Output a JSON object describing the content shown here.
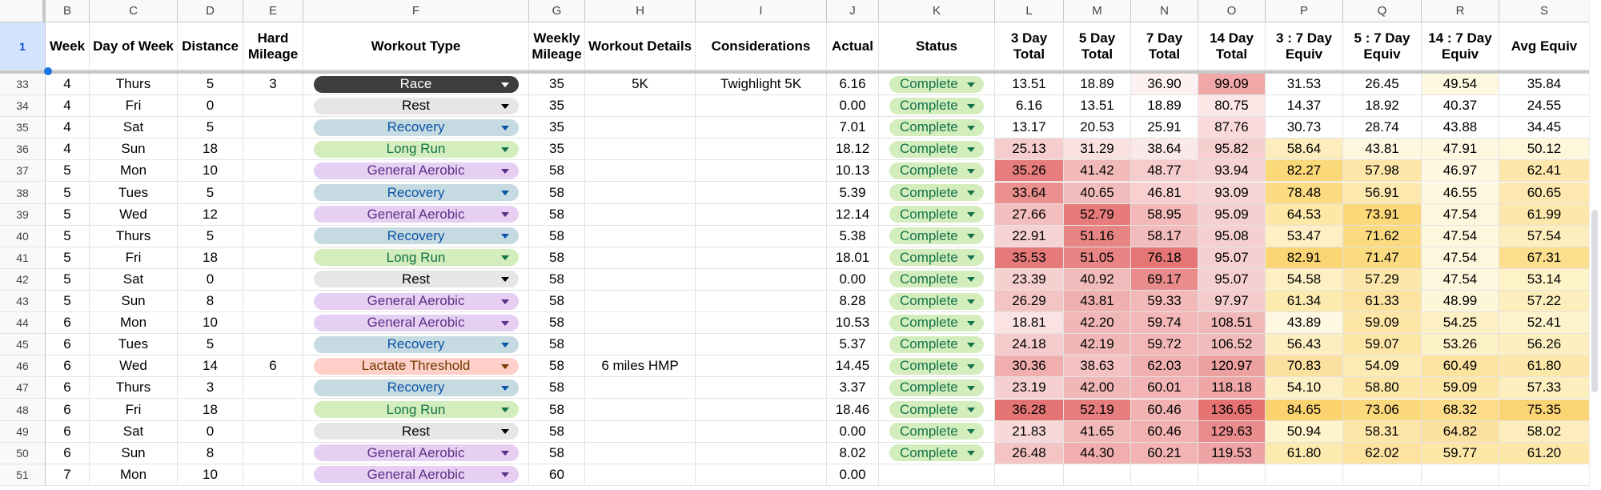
{
  "columns": [
    "B",
    "C",
    "D",
    "E",
    "F",
    "G",
    "H",
    "I",
    "J",
    "K",
    "L",
    "M",
    "N",
    "O",
    "P",
    "Q",
    "R",
    "S"
  ],
  "header_row_number": "1",
  "headers": [
    "Week",
    "Day of Week",
    "Distance",
    "Hard Mileage",
    "Workout Type",
    "Weekly Mileage",
    "Workout Details",
    "Considerations",
    "Actual",
    "Status",
    "3 Day Total",
    "5 Day Total",
    "7 Day Total",
    "14 Day Total",
    "3 : 7 Day Equiv",
    "5 : 7 Day Equiv",
    "14 : 7 Day Equiv",
    "Avg Equiv"
  ],
  "workout_type_colors": {
    "Race": {
      "bg": "#3d3d3d",
      "fg": "#ffffff"
    },
    "Rest": {
      "bg": "#e6e6e6",
      "fg": "#000000"
    },
    "Recovery": {
      "bg": "#c6dbe1",
      "fg": "#0a53a8"
    },
    "Long Run": {
      "bg": "#d4edbc",
      "fg": "#11734b"
    },
    "General Aerobic": {
      "bg": "#e6cff2",
      "fg": "#5a3286"
    },
    "Lactate Threshold": {
      "bg": "#ffcfc9",
      "fg": "#753800"
    }
  },
  "rows": [
    {
      "n": "33",
      "week": "4",
      "day": "Thurs",
      "dist": "5",
      "hard": "3",
      "type": "Race",
      "weekly": "35",
      "details": "5K",
      "cons": "Twighlight 5K",
      "actual": "6.16",
      "status": "Complete",
      "l": "13.51",
      "m": "18.89",
      "nn": "36.90",
      "o": "99.09",
      "p": "31.53",
      "q": "26.45",
      "r": "49.54",
      "s": "35.84",
      "bg": [
        "#ffffff",
        "#ffffff",
        "#fdf1f1",
        "#f0a7a7",
        "#ffffff",
        "#ffffff",
        "#fef8e0",
        "#ffffff"
      ]
    },
    {
      "n": "34",
      "week": "4",
      "day": "Fri",
      "dist": "0",
      "hard": "",
      "type": "Rest",
      "weekly": "35",
      "details": "",
      "cons": "",
      "actual": "0.00",
      "status": "Complete",
      "l": "6.16",
      "m": "13.51",
      "nn": "18.89",
      "o": "80.75",
      "p": "14.37",
      "q": "18.92",
      "r": "40.37",
      "s": "24.55",
      "bg": [
        "#ffffff",
        "#ffffff",
        "#ffffff",
        "#fde7e7",
        "#ffffff",
        "#ffffff",
        "#ffffff",
        "#ffffff"
      ]
    },
    {
      "n": "35",
      "week": "4",
      "day": "Sat",
      "dist": "5",
      "hard": "",
      "type": "Recovery",
      "weekly": "35",
      "details": "",
      "cons": "",
      "actual": "7.01",
      "status": "Complete",
      "l": "13.17",
      "m": "20.53",
      "nn": "25.91",
      "o": "87.76",
      "p": "30.73",
      "q": "28.74",
      "r": "43.88",
      "s": "34.45",
      "bg": [
        "#ffffff",
        "#ffffff",
        "#ffffff",
        "#fadada",
        "#ffffff",
        "#ffffff",
        "#ffffff",
        "#ffffff"
      ]
    },
    {
      "n": "36",
      "week": "4",
      "day": "Sun",
      "dist": "18",
      "hard": "",
      "type": "Long Run",
      "weekly": "35",
      "details": "",
      "cons": "",
      "actual": "18.12",
      "status": "Complete",
      "l": "25.13",
      "m": "31.29",
      "nn": "38.64",
      "o": "95.82",
      "p": "58.64",
      "q": "43.81",
      "r": "47.91",
      "s": "50.12",
      "bg": [
        "#f6cdcd",
        "#fbe0e0",
        "#fbe8e8",
        "#f6cfcf",
        "#fdedbc",
        "#fff8e0",
        "#fef8e0",
        "#fef7dc"
      ]
    },
    {
      "n": "37",
      "week": "5",
      "day": "Mon",
      "dist": "10",
      "hard": "",
      "type": "General Aerobic",
      "weekly": "58",
      "details": "",
      "cons": "",
      "actual": "10.13",
      "status": "Complete",
      "l": "35.26",
      "m": "41.42",
      "nn": "48.77",
      "o": "93.94",
      "p": "82.27",
      "q": "57.98",
      "r": "46.97",
      "s": "62.41",
      "bg": [
        "#e77d7d",
        "#f2b9b9",
        "#f7cccc",
        "#f6d2d2",
        "#fbd878",
        "#fde6a8",
        "#fef8e0",
        "#fde7aa"
      ]
    },
    {
      "n": "38",
      "week": "5",
      "day": "Tues",
      "dist": "5",
      "hard": "",
      "type": "Recovery",
      "weekly": "58",
      "details": "",
      "cons": "",
      "actual": "5.39",
      "status": "Complete",
      "l": "33.64",
      "m": "40.65",
      "nn": "46.81",
      "o": "93.09",
      "p": "78.48",
      "q": "56.91",
      "r": "46.55",
      "s": "60.65",
      "bg": [
        "#eb8f8f",
        "#f3bcbc",
        "#f8d0d0",
        "#f7d4d4",
        "#fbdc82",
        "#fde8ae",
        "#fef8e0",
        "#fde9b0"
      ]
    },
    {
      "n": "39",
      "week": "5",
      "day": "Wed",
      "dist": "12",
      "hard": "",
      "type": "General Aerobic",
      "weekly": "58",
      "details": "",
      "cons": "",
      "actual": "12.14",
      "status": "Complete",
      "l": "27.66",
      "m": "52.79",
      "nn": "58.95",
      "o": "95.09",
      "p": "64.53",
      "q": "73.91",
      "r": "47.54",
      "s": "61.99",
      "bg": [
        "#f2bebe",
        "#e77a7a",
        "#f3b9b9",
        "#f6d0d0",
        "#fde8a8",
        "#fbd878",
        "#fef7dd",
        "#fde7aa"
      ]
    },
    {
      "n": "40",
      "week": "5",
      "day": "Thurs",
      "dist": "5",
      "hard": "",
      "type": "Recovery",
      "weekly": "58",
      "details": "",
      "cons": "",
      "actual": "5.38",
      "status": "Complete",
      "l": "22.91",
      "m": "51.16",
      "nn": "58.17",
      "o": "95.08",
      "p": "53.47",
      "q": "71.62",
      "r": "47.54",
      "s": "57.54",
      "bg": [
        "#f7d2d2",
        "#e98484",
        "#f3bcbc",
        "#f6d0d0",
        "#fef0c4",
        "#fbdb80",
        "#fef7dd",
        "#fdeebe"
      ]
    },
    {
      "n": "41",
      "week": "5",
      "day": "Fri",
      "dist": "18",
      "hard": "",
      "type": "Long Run",
      "weekly": "58",
      "details": "",
      "cons": "",
      "actual": "18.01",
      "status": "Complete",
      "l": "35.53",
      "m": "51.05",
      "nn": "76.18",
      "o": "95.07",
      "p": "82.91",
      "q": "71.47",
      "r": "47.54",
      "s": "67.31",
      "bg": [
        "#e67a7a",
        "#e98484",
        "#e67676",
        "#f6d0d0",
        "#fbd574",
        "#fbdb80",
        "#fef7dd",
        "#fcde8c"
      ]
    },
    {
      "n": "42",
      "week": "5",
      "day": "Sat",
      "dist": "0",
      "hard": "",
      "type": "Rest",
      "weekly": "58",
      "details": "",
      "cons": "",
      "actual": "0.00",
      "status": "Complete",
      "l": "23.39",
      "m": "40.92",
      "nn": "69.17",
      "o": "95.07",
      "p": "54.58",
      "q": "57.29",
      "r": "47.54",
      "s": "53.14",
      "bg": [
        "#f6cfcf",
        "#f2bbbb",
        "#ea8c8c",
        "#f6d0d0",
        "#fdf0c4",
        "#fde7aa",
        "#fef7dd",
        "#fdf2c8"
      ]
    },
    {
      "n": "43",
      "week": "5",
      "day": "Sun",
      "dist": "8",
      "hard": "",
      "type": "General Aerobic",
      "weekly": "58",
      "details": "",
      "cons": "",
      "actual": "8.28",
      "status": "Complete",
      "l": "26.29",
      "m": "43.81",
      "nn": "59.33",
      "o": "97.97",
      "p": "61.34",
      "q": "61.33",
      "r": "48.99",
      "s": "57.22",
      "bg": [
        "#f4c4c4",
        "#f0b0b0",
        "#f3b8b8",
        "#f5cccc",
        "#fdeaae",
        "#fde3a0",
        "#fef6d8",
        "#fdeebe"
      ]
    },
    {
      "n": "44",
      "week": "6",
      "day": "Mon",
      "dist": "10",
      "hard": "",
      "type": "General Aerobic",
      "weekly": "58",
      "details": "",
      "cons": "",
      "actual": "10.53",
      "status": "Complete",
      "l": "18.81",
      "m": "42.20",
      "nn": "59.74",
      "o": "108.51",
      "p": "43.89",
      "q": "59.09",
      "r": "54.25",
      "s": "52.41",
      "bg": [
        "#fbe3e3",
        "#f1b6b6",
        "#f3b7b7",
        "#f1b8b8",
        "#fef8e2",
        "#fde6a6",
        "#fdf0c4",
        "#fdf3cc"
      ]
    },
    {
      "n": "45",
      "week": "6",
      "day": "Tues",
      "dist": "5",
      "hard": "",
      "type": "Recovery",
      "weekly": "58",
      "details": "",
      "cons": "",
      "actual": "5.37",
      "status": "Complete",
      "l": "24.18",
      "m": "42.19",
      "nn": "59.72",
      "o": "106.52",
      "p": "56.43",
      "q": "59.07",
      "r": "53.26",
      "s": "56.26",
      "bg": [
        "#f5cccc",
        "#f1b6b6",
        "#f3b7b7",
        "#f2bcbc",
        "#fdeec0",
        "#fde6a6",
        "#fdf1c8",
        "#fdefc0"
      ]
    },
    {
      "n": "46",
      "week": "6",
      "day": "Wed",
      "dist": "14",
      "hard": "6",
      "type": "Lactate Threshold",
      "weekly": "58",
      "details": "6 miles HMP",
      "cons": "",
      "actual": "14.45",
      "status": "Complete",
      "l": "30.36",
      "m": "38.63",
      "nn": "62.03",
      "o": "120.97",
      "p": "70.83",
      "q": "54.09",
      "r": "60.49",
      "s": "61.80",
      "bg": [
        "#f0aeae",
        "#f4c2c2",
        "#f1b0b0",
        "#eda0a0",
        "#fce0a0",
        "#fdebb4",
        "#fde3a0",
        "#fde8aa"
      ]
    },
    {
      "n": "47",
      "week": "6",
      "day": "Thurs",
      "dist": "3",
      "hard": "",
      "type": "Recovery",
      "weekly": "58",
      "details": "",
      "cons": "",
      "actual": "3.37",
      "status": "Complete",
      "l": "23.19",
      "m": "42.00",
      "nn": "60.01",
      "o": "118.18",
      "p": "54.10",
      "q": "58.80",
      "r": "59.09",
      "s": "57.33",
      "bg": [
        "#f6d0d0",
        "#f1b6b6",
        "#f2b4b4",
        "#eea6a6",
        "#fdf0c4",
        "#fde6a6",
        "#fde6a6",
        "#fdeebe"
      ]
    },
    {
      "n": "48",
      "week": "6",
      "day": "Fri",
      "dist": "18",
      "hard": "",
      "type": "Long Run",
      "weekly": "58",
      "details": "",
      "cons": "",
      "actual": "18.46",
      "status": "Complete",
      "l": "36.28",
      "m": "52.19",
      "nn": "60.46",
      "o": "136.65",
      "p": "84.65",
      "q": "73.06",
      "r": "68.32",
      "s": "75.35",
      "bg": [
        "#e57575",
        "#e77d7d",
        "#f2b2b2",
        "#e67272",
        "#fbd470",
        "#fbd87a",
        "#fcdc88",
        "#fbd574"
      ]
    },
    {
      "n": "49",
      "week": "6",
      "day": "Sat",
      "dist": "0",
      "hard": "",
      "type": "Rest",
      "weekly": "58",
      "details": "",
      "cons": "",
      "actual": "0.00",
      "status": "Complete",
      "l": "21.83",
      "m": "41.65",
      "nn": "60.46",
      "o": "129.63",
      "p": "50.94",
      "q": "58.31",
      "r": "64.82",
      "s": "58.02",
      "bg": [
        "#f8d8d8",
        "#f1b8b8",
        "#f2b2b2",
        "#ea8c8c",
        "#fef3cc",
        "#fde6a8",
        "#fde1a0",
        "#fdedbc"
      ]
    },
    {
      "n": "50",
      "week": "6",
      "day": "Sun",
      "dist": "8",
      "hard": "",
      "type": "General Aerobic",
      "weekly": "58",
      "details": "",
      "cons": "",
      "actual": "8.02",
      "status": "Complete",
      "l": "26.48",
      "m": "44.30",
      "nn": "60.21",
      "o": "119.53",
      "p": "61.80",
      "q": "62.02",
      "r": "59.77",
      "s": "61.20",
      "bg": [
        "#f4c4c4",
        "#f0aeae",
        "#f2b3b3",
        "#eea4a4",
        "#fdeaae",
        "#fde2a0",
        "#fde6a6",
        "#fde8aa"
      ]
    },
    {
      "n": "51",
      "week": "7",
      "day": "Mon",
      "dist": "10",
      "hard": "",
      "type": "General Aerobic",
      "weekly": "60",
      "details": "",
      "cons": "",
      "actual": "0.00",
      "status": "",
      "l": "",
      "m": "",
      "nn": "",
      "o": "",
      "p": "",
      "q": "",
      "r": "",
      "s": "",
      "bg": [
        "#ffffff",
        "#ffffff",
        "#ffffff",
        "#ffffff",
        "#ffffff",
        "#ffffff",
        "#ffffff",
        "#ffffff"
      ]
    }
  ]
}
